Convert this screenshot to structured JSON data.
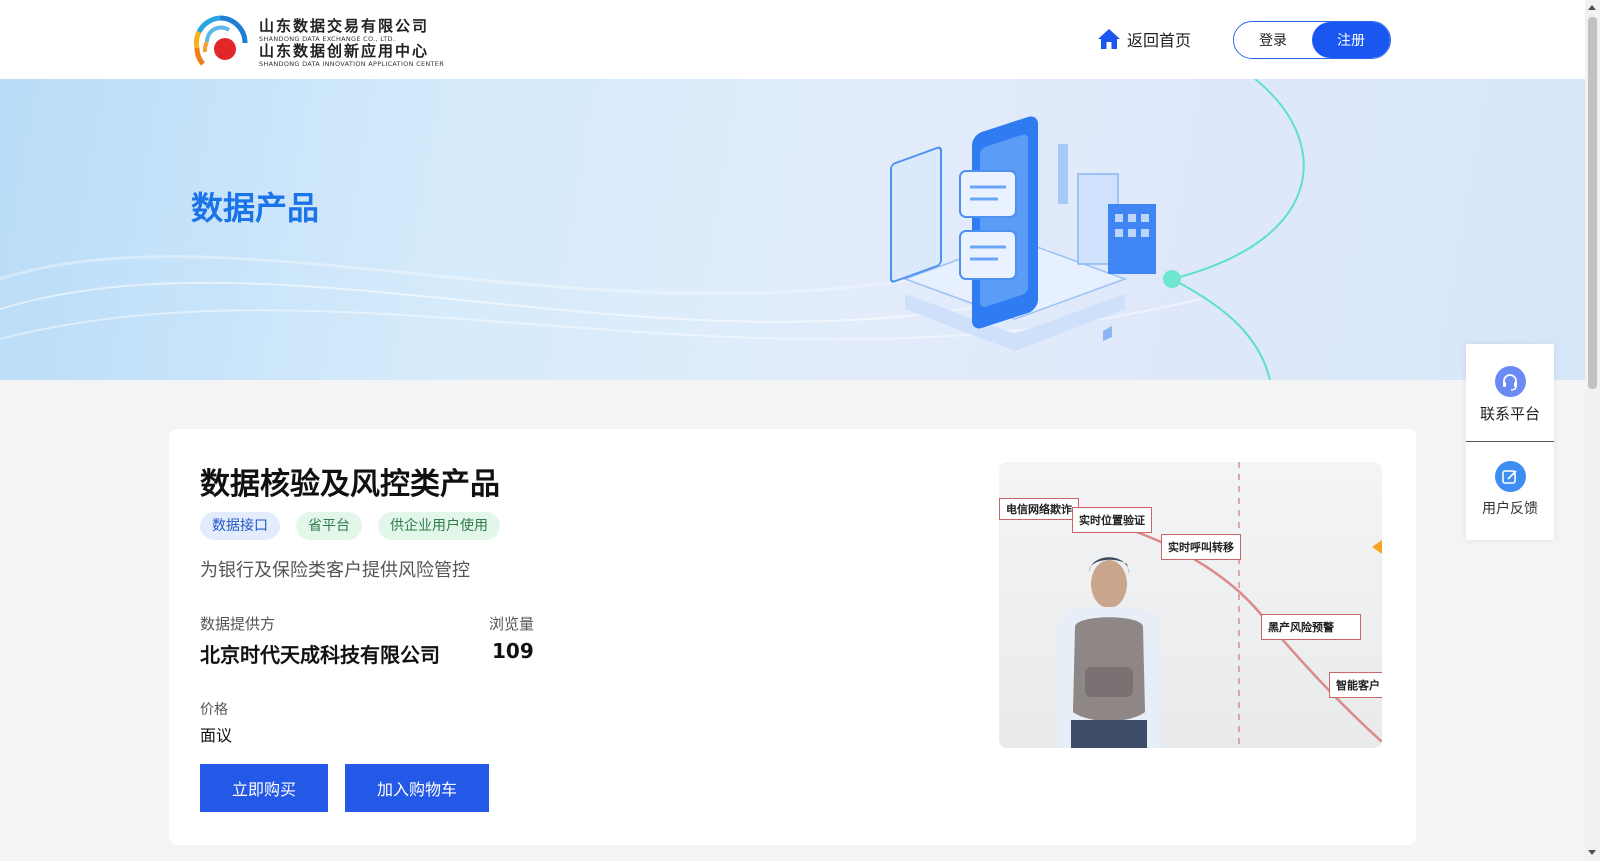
{
  "header": {
    "logo": {
      "line1_cn": "山东数据交易有限公司",
      "line1_en": "SHANDONG DATA EXCHANGE CO., LTD.",
      "line2_cn": "山东数据创新应用中心",
      "line2_en": "SHANDONG DATA INNOVATION APPLICATION CENTER"
    },
    "home_label": "返回首页",
    "login_label": "登录",
    "register_label": "注册"
  },
  "banner": {
    "title": "数据产品"
  },
  "product": {
    "title": "数据核验及风控类产品",
    "tags": [
      {
        "label": "数据接口",
        "style": "blue"
      },
      {
        "label": "省平台",
        "style": "green"
      },
      {
        "label": "供企业用户使用",
        "style": "green"
      }
    ],
    "description": "为银行及保险类客户提供风险管控",
    "provider_label": "数据提供方",
    "provider_value": "北京时代天成科技有限公司",
    "views_label": "浏览量",
    "views_value": "109",
    "price_label": "价格",
    "price_value": "面议",
    "buy_label": "立即购买",
    "cart_label": "加入购物车",
    "image_labels": [
      "电信网络欺诈",
      "实时位置验证",
      "实时呼叫转移",
      "黑产风险预警",
      "智能客户"
    ]
  },
  "float_panel": {
    "contact_label": "联系平台",
    "feedback_label": "用户反馈"
  },
  "colors": {
    "primary": "#1a56f0",
    "button": "#2458e6",
    "banner_title": "#1a73e8"
  }
}
